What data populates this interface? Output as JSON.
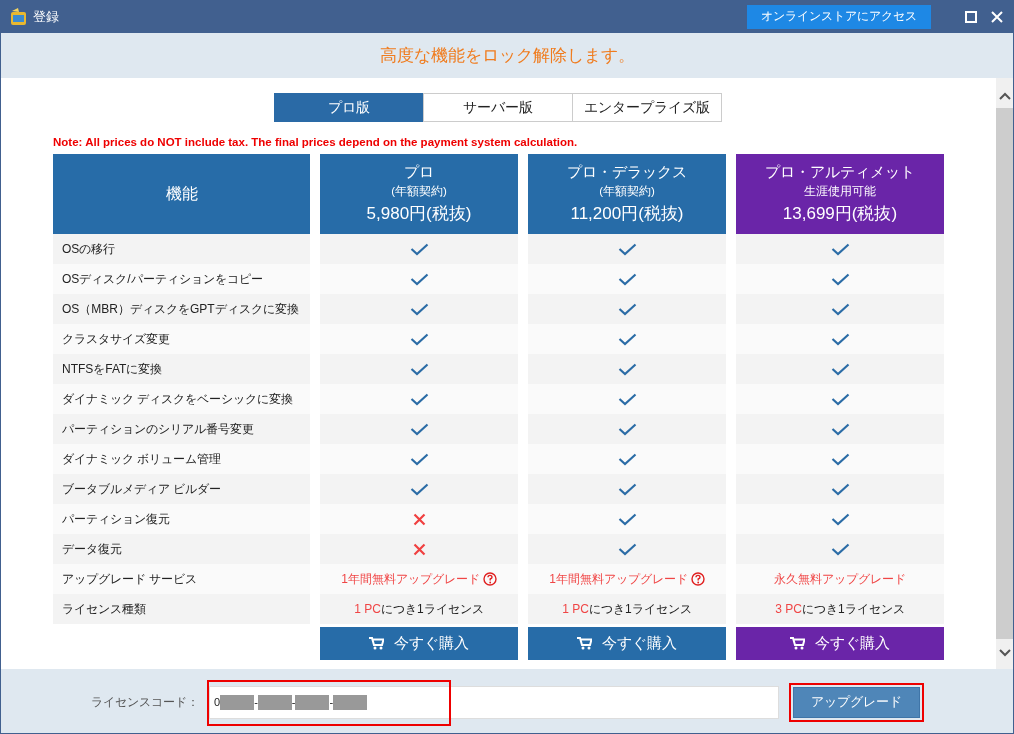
{
  "window": {
    "title": "登録",
    "store_button": "オンラインストアにアクセス"
  },
  "banner": "高度な機能をロック解除します。",
  "tabs": [
    {
      "label": "プロ版",
      "selected": true
    },
    {
      "label": "サーバー版",
      "selected": false
    },
    {
      "label": "エンタープライズ版",
      "selected": false
    }
  ],
  "note": "Note: All prices do NOT include tax. The final prices depend on the payment system calculation.",
  "feature_header": "機能",
  "plans": [
    {
      "name": "プロ",
      "term": "(年額契約)",
      "price": "5,980円(税抜)",
      "color": "#276ca8",
      "buy": "今すぐ購入"
    },
    {
      "name": "プロ・デラックス",
      "term": "(年額契約)",
      "price": "11,200円(税抜)",
      "color": "#276ca8",
      "buy": "今すぐ購入"
    },
    {
      "name": "プロ・アルティメット",
      "term": "生涯使用可能",
      "price": "13,699円(税抜)",
      "color": "#6a25a8",
      "buy": "今すぐ購入"
    }
  ],
  "rows": [
    {
      "feature": "OSの移行",
      "cells": [
        {
          "kind": "check"
        },
        {
          "kind": "check"
        },
        {
          "kind": "check"
        }
      ]
    },
    {
      "feature": "OSディスク/パーティションをコピー",
      "cells": [
        {
          "kind": "check"
        },
        {
          "kind": "check"
        },
        {
          "kind": "check"
        }
      ]
    },
    {
      "feature": "OS（MBR）ディスクをGPTディスクに変換",
      "cells": [
        {
          "kind": "check"
        },
        {
          "kind": "check"
        },
        {
          "kind": "check"
        }
      ]
    },
    {
      "feature": "クラスタサイズ変更",
      "cells": [
        {
          "kind": "check"
        },
        {
          "kind": "check"
        },
        {
          "kind": "check"
        }
      ]
    },
    {
      "feature": "NTFSをFATに変換",
      "cells": [
        {
          "kind": "check"
        },
        {
          "kind": "check"
        },
        {
          "kind": "check"
        }
      ]
    },
    {
      "feature": "ダイナミック ディスクをベーシックに変換",
      "cells": [
        {
          "kind": "check"
        },
        {
          "kind": "check"
        },
        {
          "kind": "check"
        }
      ]
    },
    {
      "feature": "パーティションのシリアル番号変更",
      "cells": [
        {
          "kind": "check"
        },
        {
          "kind": "check"
        },
        {
          "kind": "check"
        }
      ]
    },
    {
      "feature": "ダイナミック ボリューム管理",
      "cells": [
        {
          "kind": "check"
        },
        {
          "kind": "check"
        },
        {
          "kind": "check"
        }
      ]
    },
    {
      "feature": "ブータブルメディア ビルダー",
      "cells": [
        {
          "kind": "check"
        },
        {
          "kind": "check"
        },
        {
          "kind": "check"
        }
      ]
    },
    {
      "feature": "パーティション復元",
      "cells": [
        {
          "kind": "cross"
        },
        {
          "kind": "check"
        },
        {
          "kind": "check"
        }
      ]
    },
    {
      "feature": "データ復元",
      "cells": [
        {
          "kind": "cross"
        },
        {
          "kind": "check"
        },
        {
          "kind": "check"
        }
      ]
    },
    {
      "feature": "アップグレード サービス",
      "cells": [
        {
          "kind": "upgrade",
          "text": "1年間無料アップグレード",
          "help": true
        },
        {
          "kind": "upgrade",
          "text": "1年間無料アップグレード",
          "help": true
        },
        {
          "kind": "upgrade",
          "text": "永久無料アップグレード",
          "help": false
        }
      ]
    },
    {
      "feature": "ライセンス種類",
      "cells": [
        {
          "kind": "license",
          "accent": "1 PC",
          "text": "につき1ライセンス"
        },
        {
          "kind": "license",
          "accent": "1 PC",
          "text": "につき1ライセンス"
        },
        {
          "kind": "license",
          "accent": "3 PC",
          "text": "につき1ライセンス"
        }
      ]
    }
  ],
  "license": {
    "label": "ライセンスコード：",
    "code_parts": [
      "0",
      "-",
      "-",
      "-"
    ],
    "highlighted": true,
    "button": "アップグレード",
    "button_highlighted": true
  }
}
